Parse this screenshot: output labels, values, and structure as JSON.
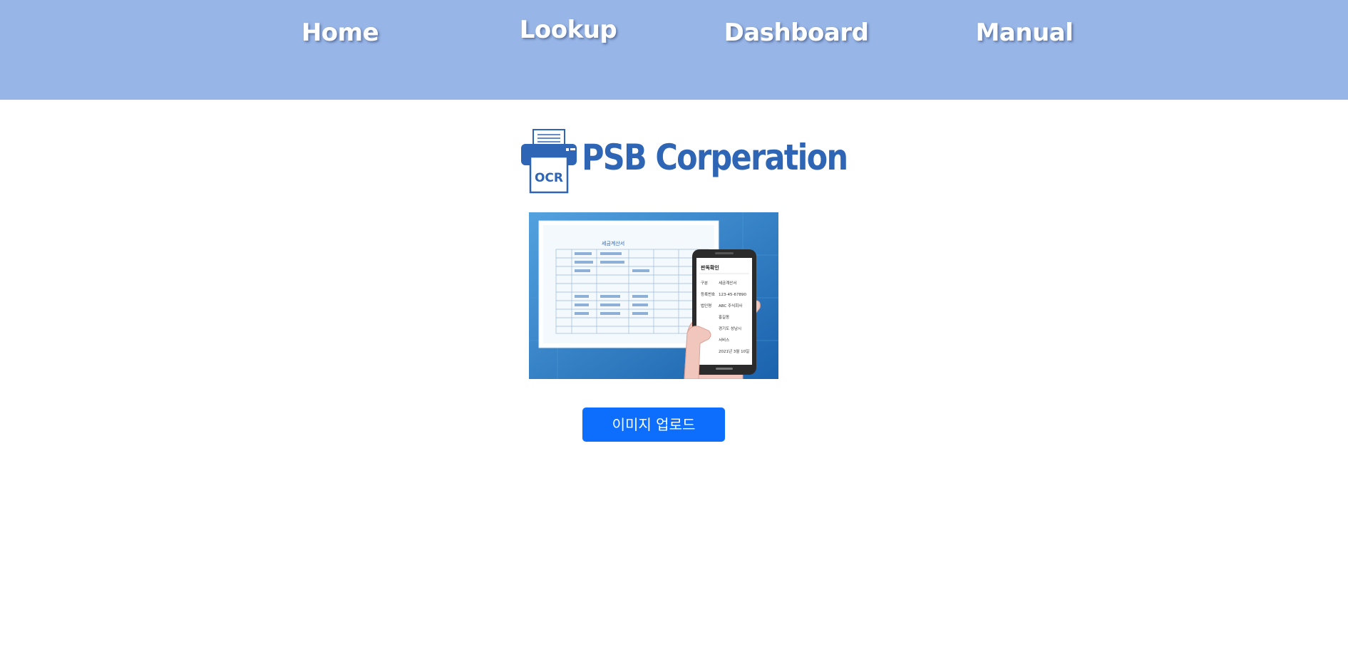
{
  "nav": {
    "items": [
      {
        "label": "Home"
      },
      {
        "label": "Lookup"
      },
      {
        "label": "Dashboard"
      },
      {
        "label": "Manual"
      }
    ]
  },
  "logo": {
    "icon_label": "OCR",
    "company": "PSB Corperation"
  },
  "illustration": {
    "document_title": "세금계산서",
    "phone_title": "판독확인",
    "phone_fields": [
      {
        "key": "구분",
        "value": "세금계산서"
      },
      {
        "key": "등록번호",
        "value": "123-45-67890"
      },
      {
        "key": "법인명",
        "value": "ABC 주식회사"
      },
      {
        "key": "",
        "value": "홍길동"
      },
      {
        "key": "",
        "value": "경기도 성남시"
      },
      {
        "key": "",
        "value": "서비스"
      },
      {
        "key": "",
        "value": "2021년 3월 10일"
      }
    ]
  },
  "upload": {
    "label": "이미지 업로드"
  },
  "colors": {
    "navbar_bg": "#97b5e6",
    "brand_blue": "#2f65b5",
    "button_bg": "#0d6efd"
  }
}
